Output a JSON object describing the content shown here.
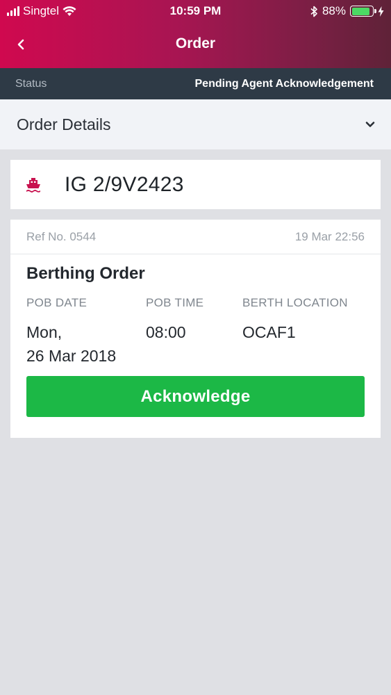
{
  "status_bar": {
    "carrier": "Singtel",
    "time": "10:59 PM",
    "battery_percent": "88%",
    "battery_level": 0.88
  },
  "nav": {
    "title": "Order"
  },
  "status": {
    "label": "Status",
    "value": "Pending Agent Acknowledgement"
  },
  "order_details": {
    "title": "Order Details"
  },
  "vessel": {
    "icon": "ship-icon",
    "name": "IG 2/9V2423"
  },
  "order": {
    "ref": "Ref No. 0544",
    "datetime": "19 Mar 22:56",
    "type": "Berthing Order",
    "pob_date_label": "POB DATE",
    "pob_date_line1": "Mon,",
    "pob_date_line2": "26 Mar 2018",
    "pob_time_label": "POB TIME",
    "pob_time": "08:00",
    "berth_label": "BERTH LOCATION",
    "berth": "OCAF1",
    "acknowledge_label": "Acknowledge"
  },
  "colors": {
    "brand": "#d0094f",
    "status_bar_bg": "#2e3a46",
    "accent_green": "#1cb846",
    "icon_red": "#c8124f"
  }
}
